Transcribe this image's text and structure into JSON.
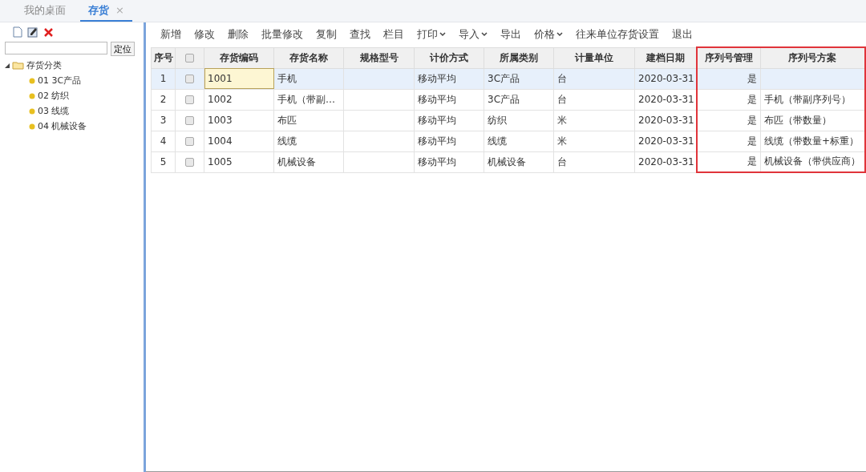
{
  "tabs": [
    {
      "label": "我的桌面",
      "selected": false,
      "closable": false
    },
    {
      "label": "存货",
      "selected": true,
      "closable": true,
      "close": "×"
    }
  ],
  "sidebar": {
    "locate_button": "定位",
    "tree": [
      {
        "label": "存货分类",
        "expanded": true,
        "children": [
          {
            "label": "01 3C产品"
          },
          {
            "label": "02 纺织"
          },
          {
            "label": "03 线缆"
          },
          {
            "label": "04 机械设备"
          }
        ]
      }
    ]
  },
  "toolbar": [
    {
      "label": "新增",
      "dropdown": false
    },
    {
      "label": "修改",
      "dropdown": false
    },
    {
      "label": "删除",
      "dropdown": false
    },
    {
      "label": "批量修改",
      "dropdown": false
    },
    {
      "label": "复制",
      "dropdown": false
    },
    {
      "label": "查找",
      "dropdown": false
    },
    {
      "label": "栏目",
      "dropdown": false
    },
    {
      "label": "打印",
      "dropdown": true
    },
    {
      "label": "导入",
      "dropdown": true
    },
    {
      "label": "导出",
      "dropdown": false
    },
    {
      "label": "价格",
      "dropdown": true
    },
    {
      "label": "往来单位存货设置",
      "dropdown": false
    },
    {
      "label": "退出",
      "dropdown": false
    }
  ],
  "table": {
    "columns": [
      {
        "label": "序号",
        "highlighted": false
      },
      {
        "label": "存货编码",
        "highlighted": false
      },
      {
        "label": "存货名称",
        "highlighted": false
      },
      {
        "label": "规格型号",
        "highlighted": false
      },
      {
        "label": "计价方式",
        "highlighted": false
      },
      {
        "label": "所属类别",
        "highlighted": false
      },
      {
        "label": "计量单位",
        "highlighted": false
      },
      {
        "label": "建档日期",
        "highlighted": false
      },
      {
        "label": "序列号管理",
        "highlighted": true
      },
      {
        "label": "序列号方案",
        "highlighted": true
      }
    ],
    "all_checked": false,
    "rows": [
      {
        "index": "1",
        "checked": false,
        "selected": true,
        "code_focused": true,
        "code": "1001",
        "name": "手机",
        "spec": "",
        "pricing": "移动平均",
        "category": "3C产品",
        "unit": "台",
        "date": "2020-03-31",
        "serial_managed": "是",
        "serial_scheme": ""
      },
      {
        "index": "2",
        "checked": false,
        "selected": false,
        "code_focused": false,
        "code": "1002",
        "name": "手机（带副…",
        "spec": "",
        "pricing": "移动平均",
        "category": "3C产品",
        "unit": "台",
        "date": "2020-03-31",
        "serial_managed": "是",
        "serial_scheme": "手机（带副序列号）"
      },
      {
        "index": "3",
        "checked": false,
        "selected": false,
        "code_focused": false,
        "code": "1003",
        "name": "布匹",
        "spec": "",
        "pricing": "移动平均",
        "category": "纺织",
        "unit": "米",
        "date": "2020-03-31",
        "serial_managed": "是",
        "serial_scheme": "布匹（带数量）"
      },
      {
        "index": "4",
        "checked": false,
        "selected": false,
        "code_focused": false,
        "code": "1004",
        "name": "线缆",
        "spec": "",
        "pricing": "移动平均",
        "category": "线缆",
        "unit": "米",
        "date": "2020-03-31",
        "serial_managed": "是",
        "serial_scheme": "线缆（带数量+标重）"
      },
      {
        "index": "5",
        "checked": false,
        "selected": false,
        "code_focused": false,
        "code": "1005",
        "name": "机械设备",
        "spec": "",
        "pricing": "移动平均",
        "category": "机械设备",
        "unit": "台",
        "date": "2020-03-31",
        "serial_managed": "是",
        "serial_scheme": "机械设备（带供应商）"
      }
    ]
  }
}
